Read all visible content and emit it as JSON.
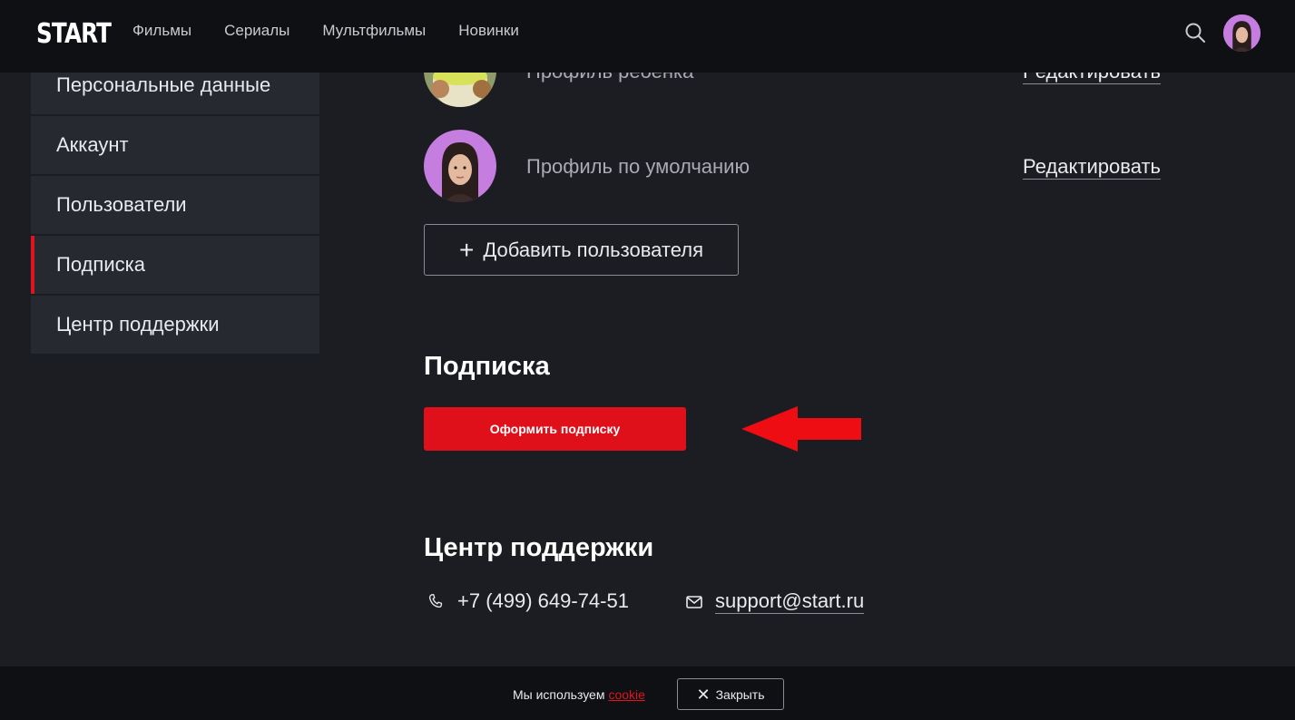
{
  "header": {
    "logo": "START",
    "nav": [
      "Фильмы",
      "Сериалы",
      "Мультфильмы",
      "Новинки"
    ],
    "icons": {
      "search": "search-icon",
      "avatar": "user-avatar"
    }
  },
  "sidebar": {
    "items": [
      {
        "label": "Персональные данные",
        "active": false
      },
      {
        "label": "Аккаунт",
        "active": false
      },
      {
        "label": "Пользователи",
        "active": false
      },
      {
        "label": "Подписка",
        "active": true
      },
      {
        "label": "Центр поддержки",
        "active": false
      }
    ]
  },
  "profiles": [
    {
      "name": "Профиль ребенка",
      "edit_label": "Редактировать"
    },
    {
      "name": "Профиль по умолчанию",
      "edit_label": "Редактировать"
    }
  ],
  "add_user": {
    "label": "Добавить пользователя"
  },
  "subscription": {
    "title": "Подписка",
    "button_label": "Оформить подписку"
  },
  "support": {
    "title": "Центр поддержки",
    "phone": "+7 (499) 649-74-51",
    "email": "support@start.ru"
  },
  "cookie_bar": {
    "text": "Мы используем",
    "link": "cookie",
    "close_label": "Закрыть"
  },
  "colors": {
    "accent": "#e0101b",
    "background": "#1c1d22",
    "header": "#0f1014",
    "sidebar_item": "#26292f"
  }
}
